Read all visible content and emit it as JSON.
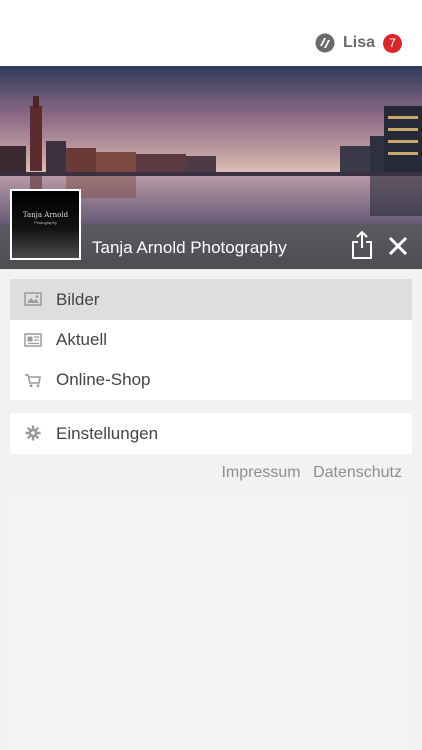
{
  "header": {
    "user_name": "Lisa",
    "notification_count": "7"
  },
  "hero": {
    "title": "Tanja Arnold Photography",
    "avatar_text": "Tanja Arnold",
    "avatar_subtext": "Photography"
  },
  "menu": {
    "items": [
      {
        "label": "Bilder",
        "icon": "image-icon",
        "active": true
      },
      {
        "label": "Aktuell",
        "icon": "news-icon",
        "active": false
      },
      {
        "label": "Online-Shop",
        "icon": "cart-icon",
        "active": false
      }
    ],
    "settings": {
      "label": "Einstellungen",
      "icon": "gear-icon"
    }
  },
  "footer": {
    "impressum": "Impressum",
    "datenschutz": "Datenschutz"
  },
  "colors": {
    "badge": "#d9262b",
    "active_item": "#dedede",
    "background": "#f2f2f2"
  }
}
